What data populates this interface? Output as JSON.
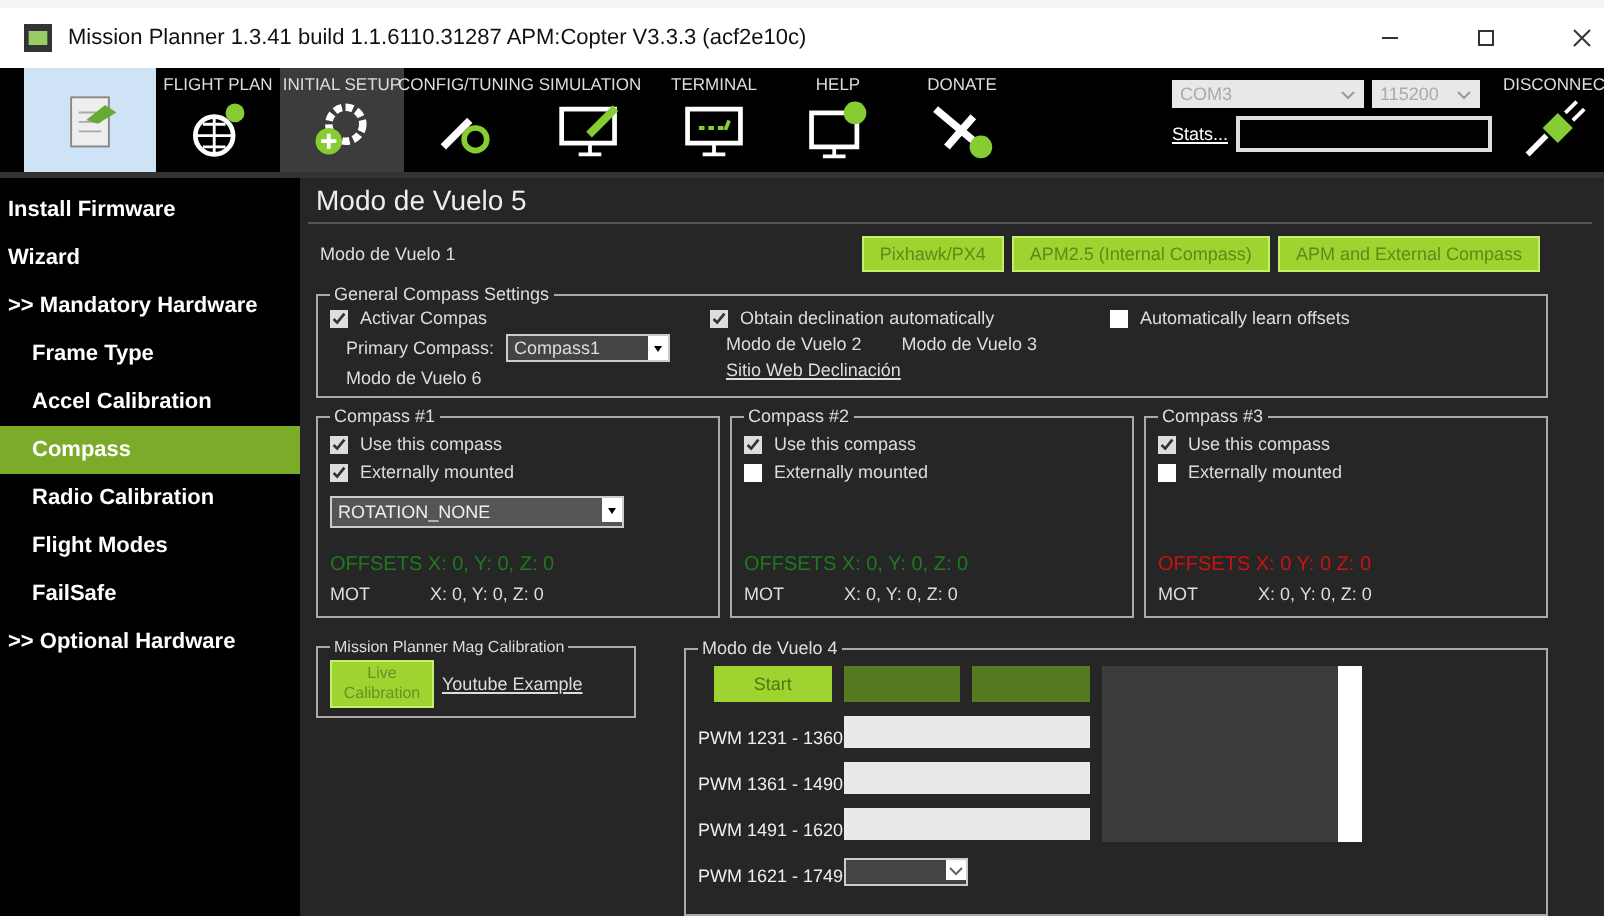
{
  "window": {
    "title": "Mission Planner 1.3.41 build 1.1.6110.31287 APM:Copter V3.3.3 (acf2e10c)"
  },
  "toolbar": [
    {
      "kind": "data",
      "selected": false
    },
    {
      "kind": "plan",
      "label": "FLIGHT PLAN",
      "selected": false
    },
    {
      "kind": "setup",
      "label": "INITIAL SETUP",
      "selected": true
    },
    {
      "kind": "config",
      "label": "CONFIG/TUNING",
      "selected": false
    },
    {
      "kind": "sim",
      "label": "SIMULATION",
      "selected": false
    },
    {
      "kind": "terminal",
      "label": "TERMINAL",
      "selected": false
    },
    {
      "kind": "help",
      "label": "HELP",
      "selected": false
    },
    {
      "kind": "donate",
      "label": "DONATE",
      "selected": false
    }
  ],
  "connection": {
    "port": "COM3",
    "baud": "115200",
    "stats": "Stats...",
    "disconnect": "DISCONNEC"
  },
  "sidebar": [
    {
      "label": "Install Firmware",
      "kind": "top",
      "selected": false
    },
    {
      "label": "Wizard",
      "kind": "top",
      "selected": false
    },
    {
      "label": ">> Mandatory Hardware",
      "kind": "top",
      "selected": false
    },
    {
      "label": "Frame Type",
      "kind": "sub",
      "selected": false
    },
    {
      "label": "Accel Calibration",
      "kind": "sub",
      "selected": false
    },
    {
      "label": "Compass",
      "kind": "sub",
      "selected": true
    },
    {
      "label": "Radio Calibration",
      "kind": "sub",
      "selected": false
    },
    {
      "label": "Flight Modes",
      "kind": "sub",
      "selected": false
    },
    {
      "label": "FailSafe",
      "kind": "sub",
      "selected": false
    },
    {
      "label": ">> Optional Hardware",
      "kind": "top",
      "selected": false
    }
  ],
  "page_title": "Modo de Vuelo 5",
  "board_label": "Modo de Vuelo 1",
  "board_buttons": [
    "Pixhawk/PX4",
    "APM2.5 (Internal Compass)",
    "APM and External Compass"
  ],
  "general": {
    "legend": "General Compass Settings",
    "enable": {
      "label": "Activar Compas",
      "checked": true
    },
    "declination": {
      "label": "Obtain declination automatically",
      "checked": true
    },
    "learn": {
      "label": "Automatically learn offsets",
      "checked": false
    },
    "primary_label": "Primary Compass:",
    "primary_value": "Compass1",
    "label_6": "Modo de Vuelo 6",
    "label_2": "Modo de Vuelo 2",
    "label_3": "Modo de Vuelo 3",
    "link": "Sitio Web Declinación"
  },
  "compasses": [
    {
      "title": "Compass #1",
      "use": {
        "label": "Use this compass",
        "checked": true
      },
      "external": {
        "label": "Externally mounted",
        "checked": true
      },
      "rotation": "ROTATION_NONE",
      "offsets": "OFFSETS  X: 0,  Y: 0,  Z: 0",
      "color": "#1f7a1f",
      "mot": "MOT",
      "mot_values": "X: 0,  Y: 0,  Z: 0"
    },
    {
      "title": "Compass #2",
      "use": {
        "label": "Use this compass",
        "checked": true
      },
      "external": {
        "label": "Externally mounted",
        "checked": false
      },
      "offsets": "OFFSETS  X: 0,  Y: 0,  Z: 0",
      "color": "#1f7a1f",
      "mot": "MOT",
      "mot_values": "X: 0,  Y: 0,  Z: 0"
    },
    {
      "title": "Compass #3",
      "use": {
        "label": "Use this compass",
        "checked": true
      },
      "external": {
        "label": "Externally mounted",
        "checked": false
      },
      "offsets": "OFFSETS  X: 0  Y: 0  Z: 0",
      "color": "#d01010",
      "mot": "MOT",
      "mot_values": "X: 0,  Y: 0,  Z: 0"
    }
  ],
  "mag": {
    "legend": "Mission Planner Mag Calibration",
    "button": "Live Calibration",
    "link": "Youtube Example"
  },
  "panel4": {
    "legend": "Modo de Vuelo 4",
    "buttons": [
      {
        "label": "Start",
        "disabled": false
      },
      {
        "disabled": true
      },
      {
        "disabled": true
      }
    ],
    "pwm": [
      {
        "label": "PWM 1231 - 1360",
        "kind": "bar"
      },
      {
        "label": "PWM 1361 - 1490",
        "kind": "bar"
      },
      {
        "label": "PWM 1491 - 1620",
        "kind": "bar"
      },
      {
        "label": "PWM 1621 - 1749",
        "kind": "dropdown"
      }
    ]
  }
}
